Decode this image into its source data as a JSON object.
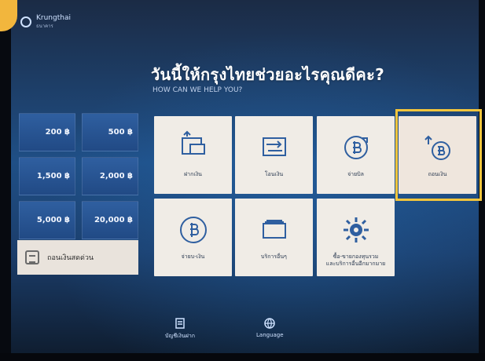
{
  "app": {
    "brand_name": "Krungthai",
    "brand_tag": "ธนาคาร"
  },
  "header": {
    "title": "วันนี้ให้กรุงไทยช่วยอะไรคุณดีคะ?",
    "subtitle": "HOW CAN WE HELP YOU?"
  },
  "quick_withdraw": {
    "amounts": [
      "200 ฿",
      "500 ฿",
      "1,500 ฿",
      "2,000 ฿",
      "5,000 ฿",
      "20,000 ฿"
    ]
  },
  "balance": {
    "label": "ถอนเงินสดด่วน"
  },
  "services": [
    {
      "label": "ฝากเงิน",
      "icon": "deposit-icon"
    },
    {
      "label": "โอนเงิน",
      "icon": "transfer-icon"
    },
    {
      "label": "จ่ายบิล",
      "icon": "bill-payment-icon"
    },
    {
      "label": "ถอนเงิน",
      "icon": "withdraw-icon"
    },
    {
      "label": "จ่ายบ-เงิน",
      "icon": "baht-coin-icon"
    },
    {
      "label": "บริการอื่นๆ",
      "icon": "card-stack-icon"
    },
    {
      "label": "ซื้อ-ขายกองทุนรวม\nและบริการอื่นอีกมากมาย",
      "icon": "settings-gear-icon"
    }
  ],
  "bottom_nav": {
    "left_label": "บัญชีเงินฝาก",
    "right_label": "Language"
  },
  "colors": {
    "accent_yellow": "#f3c53c",
    "tile_bg": "#f0ece6",
    "amount_blue": "#2f5fa0"
  }
}
